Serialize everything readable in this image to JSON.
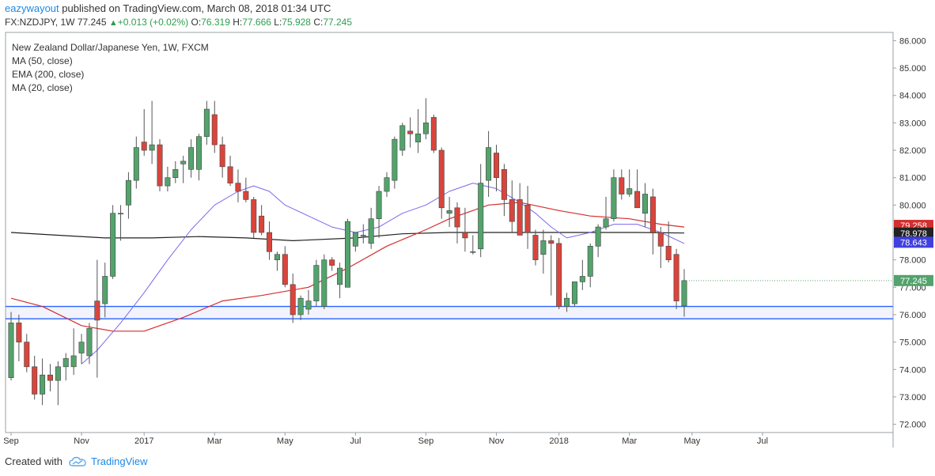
{
  "header": {
    "user": "eazywayout",
    "published": "published on TradingView.com, March 08, 2018 01:34 UTC"
  },
  "ohlc_line": {
    "symbol": "FX:NZDJPY, 1W",
    "price": "77.245",
    "change": "+0.013 (+0.02%)",
    "o_label": "O:",
    "o": "76.319",
    "h_label": "H:",
    "h": "77.666",
    "l_label": "L:",
    "l": "75.928",
    "c_label": "C:",
    "c": "77.245",
    "up_color": "#2e9e4f"
  },
  "footer": {
    "created_with": "Created with",
    "brand": "TradingView",
    "logo_icon": "tradingview-cloud-icon"
  },
  "chart_data": {
    "type": "candlestick",
    "title": "New Zealand Dollar/Japanese Yen, 1W, FXCM",
    "legend": [
      "MA (50, close)",
      "EMA (200, close)",
      "MA (20, close)"
    ],
    "ylim": [
      71.7,
      86.3
    ],
    "y_ticks": [
      "86.000",
      "85.000",
      "84.000",
      "83.000",
      "82.000",
      "81.000",
      "80.000",
      "79.000",
      "78.000",
      "77.000",
      "76.000",
      "75.000",
      "74.000",
      "73.000",
      "72.000"
    ],
    "x_ticks": [
      {
        "label": "Sep",
        "week": 0
      },
      {
        "label": "Nov",
        "week": 9
      },
      {
        "label": "2017",
        "week": 17
      },
      {
        "label": "Mar",
        "week": 26
      },
      {
        "label": "May",
        "week": 35
      },
      {
        "label": "Jul",
        "week": 44
      },
      {
        "label": "Sep",
        "week": 53
      },
      {
        "label": "Nov",
        "week": 62
      },
      {
        "label": "2018",
        "week": 70
      },
      {
        "label": "Mar",
        "week": 79
      },
      {
        "label": "May",
        "week": 87
      },
      {
        "label": "Jul",
        "week": 96
      }
    ],
    "colors": {
      "up": "#53a36c",
      "down": "#d9453c",
      "ma50": "#d32f2f",
      "ema200": "#222222",
      "ma20": "#7b68ee",
      "hline": "#2962ff"
    },
    "candles": [
      {
        "o": 73.7,
        "h": 76.1,
        "l": 73.6,
        "c": 75.7
      },
      {
        "o": 75.7,
        "h": 76.0,
        "l": 74.3,
        "c": 75.0
      },
      {
        "o": 75.0,
        "h": 75.3,
        "l": 73.9,
        "c": 74.1
      },
      {
        "o": 74.1,
        "h": 74.5,
        "l": 72.9,
        "c": 73.1
      },
      {
        "o": 73.1,
        "h": 74.4,
        "l": 72.7,
        "c": 73.8
      },
      {
        "o": 73.8,
        "h": 74.2,
        "l": 73.2,
        "c": 73.6
      },
      {
        "o": 73.6,
        "h": 74.3,
        "l": 72.7,
        "c": 74.1
      },
      {
        "o": 74.1,
        "h": 74.6,
        "l": 73.6,
        "c": 74.4
      },
      {
        "o": 74.1,
        "h": 75.5,
        "l": 73.8,
        "c": 74.5
      },
      {
        "o": 74.6,
        "h": 75.3,
        "l": 74.2,
        "c": 75.0
      },
      {
        "o": 74.5,
        "h": 75.7,
        "l": 74.2,
        "c": 75.5
      },
      {
        "o": 76.5,
        "h": 78.0,
        "l": 73.7,
        "c": 75.8
      },
      {
        "o": 76.4,
        "h": 77.9,
        "l": 75.9,
        "c": 77.4
      },
      {
        "o": 77.4,
        "h": 80.0,
        "l": 77.3,
        "c": 79.7
      },
      {
        "o": 79.7,
        "h": 80.0,
        "l": 78.7,
        "c": 79.7
      },
      {
        "o": 80.0,
        "h": 81.2,
        "l": 79.5,
        "c": 80.9
      },
      {
        "o": 80.9,
        "h": 82.5,
        "l": 80.6,
        "c": 82.1
      },
      {
        "o": 82.3,
        "h": 83.5,
        "l": 81.8,
        "c": 82.0
      },
      {
        "o": 82.0,
        "h": 83.8,
        "l": 81.5,
        "c": 82.2
      },
      {
        "o": 82.2,
        "h": 82.4,
        "l": 80.5,
        "c": 80.7
      },
      {
        "o": 80.7,
        "h": 81.4,
        "l": 80.5,
        "c": 81.0
      },
      {
        "o": 81.0,
        "h": 81.6,
        "l": 80.8,
        "c": 81.3
      },
      {
        "o": 81.5,
        "h": 81.8,
        "l": 80.8,
        "c": 81.6
      },
      {
        "o": 81.3,
        "h": 82.4,
        "l": 81.0,
        "c": 82.1
      },
      {
        "o": 81.3,
        "h": 82.6,
        "l": 80.9,
        "c": 82.5
      },
      {
        "o": 82.5,
        "h": 83.8,
        "l": 82.2,
        "c": 83.5
      },
      {
        "o": 83.3,
        "h": 83.8,
        "l": 81.9,
        "c": 82.2
      },
      {
        "o": 82.2,
        "h": 82.5,
        "l": 81.0,
        "c": 81.4
      },
      {
        "o": 81.4,
        "h": 81.8,
        "l": 80.7,
        "c": 80.8
      },
      {
        "o": 80.8,
        "h": 81.3,
        "l": 80.1,
        "c": 80.5
      },
      {
        "o": 80.5,
        "h": 81.0,
        "l": 80.1,
        "c": 80.2
      },
      {
        "o": 80.2,
        "h": 80.3,
        "l": 78.8,
        "c": 79.0
      },
      {
        "o": 79.6,
        "h": 80.0,
        "l": 78.9,
        "c": 79.0
      },
      {
        "o": 79.0,
        "h": 79.4,
        "l": 78.0,
        "c": 78.3
      },
      {
        "o": 78.0,
        "h": 78.3,
        "l": 77.6,
        "c": 78.2
      },
      {
        "o": 78.2,
        "h": 78.5,
        "l": 77.0,
        "c": 77.1
      },
      {
        "o": 77.1,
        "h": 77.5,
        "l": 75.7,
        "c": 76.0
      },
      {
        "o": 76.0,
        "h": 76.7,
        "l": 75.8,
        "c": 76.6
      },
      {
        "o": 76.2,
        "h": 76.9,
        "l": 76.0,
        "c": 76.5
      },
      {
        "o": 76.5,
        "h": 78.0,
        "l": 76.3,
        "c": 77.8
      },
      {
        "o": 76.3,
        "h": 78.2,
        "l": 76.2,
        "c": 78.0
      },
      {
        "o": 78.0,
        "h": 78.1,
        "l": 77.6,
        "c": 77.8
      },
      {
        "o": 77.1,
        "h": 77.9,
        "l": 76.6,
        "c": 77.7
      },
      {
        "o": 77.0,
        "h": 79.5,
        "l": 77.0,
        "c": 79.4
      },
      {
        "o": 78.5,
        "h": 78.9,
        "l": 78.3,
        "c": 79.0
      },
      {
        "o": 78.9,
        "h": 79.3,
        "l": 78.6,
        "c": 78.9
      },
      {
        "o": 78.6,
        "h": 79.9,
        "l": 78.4,
        "c": 79.5
      },
      {
        "o": 79.5,
        "h": 80.7,
        "l": 78.8,
        "c": 80.5
      },
      {
        "o": 80.5,
        "h": 81.2,
        "l": 80.3,
        "c": 81.0
      },
      {
        "o": 80.9,
        "h": 82.5,
        "l": 80.6,
        "c": 82.4
      },
      {
        "o": 82.0,
        "h": 83.0,
        "l": 81.8,
        "c": 82.9
      },
      {
        "o": 82.7,
        "h": 83.2,
        "l": 82.1,
        "c": 82.6
      },
      {
        "o": 82.3,
        "h": 83.5,
        "l": 81.9,
        "c": 82.6
      },
      {
        "o": 82.6,
        "h": 83.9,
        "l": 82.4,
        "c": 83.0
      },
      {
        "o": 83.2,
        "h": 83.3,
        "l": 81.9,
        "c": 82.0
      },
      {
        "o": 82.0,
        "h": 82.1,
        "l": 79.5,
        "c": 79.9
      },
      {
        "o": 79.7,
        "h": 80.3,
        "l": 79.2,
        "c": 79.8
      },
      {
        "o": 79.9,
        "h": 80.1,
        "l": 78.6,
        "c": 79.2
      },
      {
        "o": 79.0,
        "h": 79.9,
        "l": 78.3,
        "c": 78.8
      },
      {
        "o": 78.3,
        "h": 78.9,
        "l": 78.2,
        "c": 78.3
      },
      {
        "o": 78.4,
        "h": 81.5,
        "l": 78.1,
        "c": 80.8
      },
      {
        "o": 80.9,
        "h": 82.7,
        "l": 80.3,
        "c": 82.1
      },
      {
        "o": 81.9,
        "h": 82.2,
        "l": 80.5,
        "c": 81.0
      },
      {
        "o": 81.3,
        "h": 81.5,
        "l": 79.6,
        "c": 80.2
      },
      {
        "o": 80.2,
        "h": 80.9,
        "l": 79.0,
        "c": 79.4
      },
      {
        "o": 80.2,
        "h": 80.8,
        "l": 78.9,
        "c": 78.9
      },
      {
        "o": 80.0,
        "h": 80.7,
        "l": 78.4,
        "c": 79.0
      },
      {
        "o": 78.9,
        "h": 79.1,
        "l": 77.8,
        "c": 78.0
      },
      {
        "o": 78.2,
        "h": 79.1,
        "l": 77.5,
        "c": 78.7
      },
      {
        "o": 78.7,
        "h": 78.9,
        "l": 76.7,
        "c": 78.6
      },
      {
        "o": 78.6,
        "h": 78.8,
        "l": 76.2,
        "c": 76.3
      },
      {
        "o": 76.3,
        "h": 76.8,
        "l": 76.1,
        "c": 76.6
      },
      {
        "o": 76.4,
        "h": 77.2,
        "l": 76.3,
        "c": 77.2
      },
      {
        "o": 77.2,
        "h": 78.0,
        "l": 76.9,
        "c": 77.4
      },
      {
        "o": 77.4,
        "h": 78.6,
        "l": 77.0,
        "c": 78.5
      },
      {
        "o": 78.5,
        "h": 79.3,
        "l": 78.1,
        "c": 79.2
      },
      {
        "o": 79.2,
        "h": 80.3,
        "l": 79.1,
        "c": 79.5
      },
      {
        "o": 79.5,
        "h": 81.3,
        "l": 79.4,
        "c": 81.0
      },
      {
        "o": 81.0,
        "h": 81.3,
        "l": 80.2,
        "c": 80.4
      },
      {
        "o": 80.4,
        "h": 81.3,
        "l": 80.3,
        "c": 80.6
      },
      {
        "o": 80.5,
        "h": 81.3,
        "l": 79.9,
        "c": 79.9
      },
      {
        "o": 79.7,
        "h": 80.8,
        "l": 79.2,
        "c": 80.4
      },
      {
        "o": 80.3,
        "h": 80.6,
        "l": 78.2,
        "c": 79.0
      },
      {
        "o": 79.0,
        "h": 79.2,
        "l": 77.7,
        "c": 78.5
      },
      {
        "o": 78.5,
        "h": 79.4,
        "l": 77.9,
        "c": 78.0
      },
      {
        "o": 78.2,
        "h": 78.4,
        "l": 76.2,
        "c": 76.5
      },
      {
        "o": 76.319,
        "h": 77.666,
        "l": 75.928,
        "c": 77.245
      }
    ],
    "ma50": [
      {
        "w": 0,
        "v": 76.6
      },
      {
        "w": 4,
        "v": 76.3
      },
      {
        "w": 9,
        "v": 75.6
      },
      {
        "w": 13,
        "v": 75.4
      },
      {
        "w": 17,
        "v": 75.4
      },
      {
        "w": 22,
        "v": 75.9
      },
      {
        "w": 27,
        "v": 76.5
      },
      {
        "w": 32,
        "v": 76.7
      },
      {
        "w": 38,
        "v": 77.0
      },
      {
        "w": 43,
        "v": 77.7
      },
      {
        "w": 48,
        "v": 78.5
      },
      {
        "w": 53,
        "v": 79.1
      },
      {
        "w": 56,
        "v": 79.5
      },
      {
        "w": 61,
        "v": 80.0
      },
      {
        "w": 65,
        "v": 80.1
      },
      {
        "w": 70,
        "v": 79.8
      },
      {
        "w": 74,
        "v": 79.6
      },
      {
        "w": 79,
        "v": 79.5
      },
      {
        "w": 83,
        "v": 79.3
      },
      {
        "w": 86,
        "v": 79.2
      }
    ],
    "ema200": [
      {
        "w": 0,
        "v": 79.0
      },
      {
        "w": 6,
        "v": 78.9
      },
      {
        "w": 12,
        "v": 78.8
      },
      {
        "w": 18,
        "v": 78.8
      },
      {
        "w": 24,
        "v": 78.85
      },
      {
        "w": 30,
        "v": 78.8
      },
      {
        "w": 36,
        "v": 78.7
      },
      {
        "w": 44,
        "v": 78.8
      },
      {
        "w": 50,
        "v": 78.95
      },
      {
        "w": 56,
        "v": 79.0
      },
      {
        "w": 62,
        "v": 79.0
      },
      {
        "w": 68,
        "v": 79.0
      },
      {
        "w": 74,
        "v": 79.0
      },
      {
        "w": 80,
        "v": 79.0
      },
      {
        "w": 86,
        "v": 78.98
      }
    ],
    "ma20": [
      {
        "w": 9,
        "v": 74.2
      },
      {
        "w": 11,
        "v": 74.7
      },
      {
        "w": 14,
        "v": 75.7
      },
      {
        "w": 17,
        "v": 76.8
      },
      {
        "w": 20,
        "v": 78.0
      },
      {
        "w": 23,
        "v": 79.1
      },
      {
        "w": 26,
        "v": 80.0
      },
      {
        "w": 29,
        "v": 80.5
      },
      {
        "w": 31,
        "v": 80.7
      },
      {
        "w": 33,
        "v": 80.5
      },
      {
        "w": 35,
        "v": 80.0
      },
      {
        "w": 38,
        "v": 79.6
      },
      {
        "w": 41,
        "v": 79.2
      },
      {
        "w": 44,
        "v": 79.0
      },
      {
        "w": 47,
        "v": 79.2
      },
      {
        "w": 50,
        "v": 79.7
      },
      {
        "w": 53,
        "v": 80.0
      },
      {
        "w": 56,
        "v": 80.5
      },
      {
        "w": 59,
        "v": 80.8
      },
      {
        "w": 62,
        "v": 80.6
      },
      {
        "w": 65,
        "v": 80.1
      },
      {
        "w": 67,
        "v": 79.7
      },
      {
        "w": 69,
        "v": 79.2
      },
      {
        "w": 71,
        "v": 78.8
      },
      {
        "w": 74,
        "v": 79.0
      },
      {
        "w": 77,
        "v": 79.3
      },
      {
        "w": 80,
        "v": 79.3
      },
      {
        "w": 83,
        "v": 79.0
      },
      {
        "w": 86,
        "v": 78.6
      }
    ],
    "hlines": [
      76.3,
      75.85
    ],
    "labels": [
      {
        "value": 79.258,
        "text": "79.258",
        "color": "#d32f2f"
      },
      {
        "value": 78.978,
        "text": "78.978",
        "color": "#222222"
      },
      {
        "value": 78.643,
        "text": "78.643",
        "color": "#4040e0"
      },
      {
        "value": 77.245,
        "text": "77.245",
        "color": "#53a36c"
      }
    ]
  }
}
